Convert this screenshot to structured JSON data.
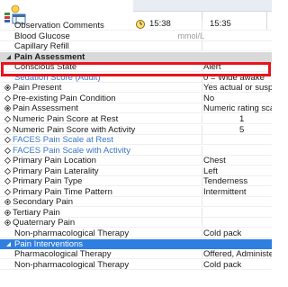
{
  "header": {
    "time1": "15:38",
    "time2": "15:35"
  },
  "rows": [
    {
      "id": "observation-comments",
      "label": "Observation Comments",
      "indent": 16,
      "blue": false,
      "value": ""
    },
    {
      "id": "blood-glucose",
      "label": "Blood Glucose",
      "unit": "mmol/L",
      "indent": 16,
      "value": ""
    },
    {
      "id": "capillary-refill",
      "label": "Capillary Refill",
      "indent": 16,
      "value": ""
    },
    {
      "id": "pain-assessment-section",
      "label": "Pain Assessment",
      "section": true
    },
    {
      "id": "conscious-state",
      "label": "Conscious State",
      "indent": 16,
      "value": "Alert"
    },
    {
      "id": "sedation-score",
      "label": "Sedation Score (Adult)",
      "indent": 16,
      "blue": true,
      "value": "0 = Wide awake"
    },
    {
      "id": "pain-present",
      "label": "Pain Present",
      "icon": "diamond-filled",
      "value": "Yes actual or suspected"
    },
    {
      "id": "pre-existing-pain",
      "label": "Pre-existing Pain Condition",
      "icon": "diamond",
      "value": "No"
    },
    {
      "id": "pain-assessment",
      "label": "Pain Assessment",
      "icon": "diamond-filled",
      "value": "Numeric rating scale"
    },
    {
      "id": "numeric-pain-rest",
      "label": "Numeric Pain Score at Rest",
      "icon": "diamond",
      "value": "1",
      "center": true
    },
    {
      "id": "numeric-pain-activity",
      "label": "Numeric Pain Score with Activity",
      "icon": "diamond",
      "value": "5",
      "center": true
    },
    {
      "id": "faces-pain-rest",
      "label": "FACES Pain Scale at Rest",
      "icon": "diamond",
      "blue": true,
      "value": ""
    },
    {
      "id": "faces-pain-activity",
      "label": "FACES Pain Scale with Activity",
      "icon": "diamond",
      "blue": true,
      "value": ""
    },
    {
      "id": "primary-pain-location",
      "label": "Primary Pain Location",
      "icon": "diamond",
      "value": "Chest"
    },
    {
      "id": "primary-pain-laterality",
      "label": "Primary Pain Laterality",
      "icon": "diamond",
      "value": "Left"
    },
    {
      "id": "primary-pain-type",
      "label": "Primary Pain Type",
      "icon": "diamond",
      "value": "Tenderness"
    },
    {
      "id": "primary-pain-time-pattern",
      "label": "Primary Pain Time Pattern",
      "icon": "diamond",
      "value": "Intermittent"
    },
    {
      "id": "secondary-pain",
      "label": "Secondary Pain",
      "icon": "diamond-plus",
      "value": ""
    },
    {
      "id": "tertiary-pain",
      "label": "Tertiary Pain",
      "icon": "diamond-plus",
      "value": ""
    },
    {
      "id": "quaternary-pain",
      "label": "Quaternary Pain",
      "icon": "diamond-plus",
      "value": ""
    },
    {
      "id": "non-pharm-therapy-1",
      "label": "Non-pharmacological Therapy",
      "indent": 16,
      "value": "Cold pack"
    },
    {
      "id": "pain-interventions-section",
      "label": "Pain Interventions",
      "selected": true
    },
    {
      "id": "pharmacological-therapy",
      "label": "Pharmacological Therapy",
      "indent": 16,
      "value": "Offered, Administered"
    },
    {
      "id": "non-pharm-therapy-2",
      "label": "Non-pharmacological Therapy",
      "indent": 16,
      "value": "Cold pack"
    }
  ]
}
